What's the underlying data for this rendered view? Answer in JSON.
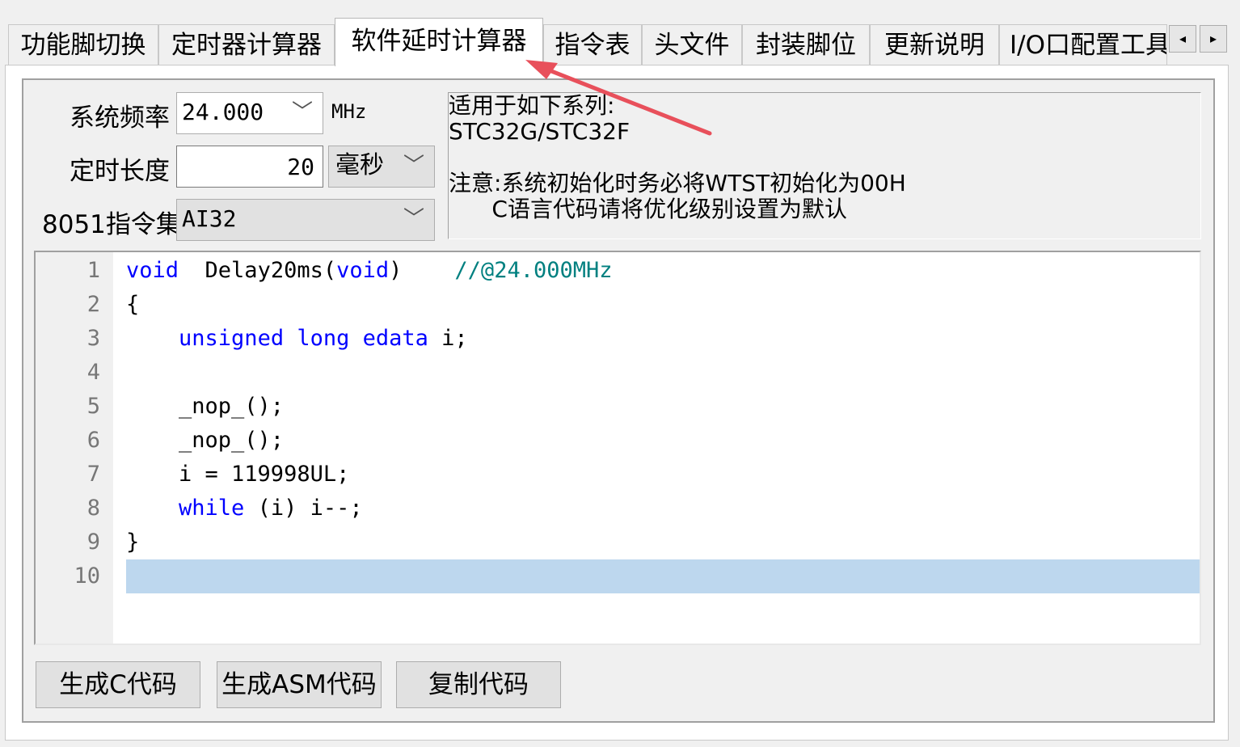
{
  "tabs": [
    {
      "label": "功能脚切换",
      "active": false
    },
    {
      "label": "定时器计算器",
      "active": false
    },
    {
      "label": "软件延时计算器",
      "active": true
    },
    {
      "label": "指令表",
      "active": false
    },
    {
      "label": "头文件",
      "active": false
    },
    {
      "label": "封装脚位",
      "active": false
    },
    {
      "label": "更新说明",
      "active": false
    },
    {
      "label": "I/O口配置工具",
      "active": false
    }
  ],
  "tab_scroll": {
    "left": "◂",
    "right": "▸"
  },
  "form": {
    "freq_label": "系统频率",
    "freq_value": "24.000",
    "freq_unit": "MHz",
    "length_label": "定时长度",
    "length_value": "20",
    "length_unit": "毫秒",
    "isa_label": "8051指令集",
    "isa_value": "AI32",
    "dropdown_glyph": "﹀"
  },
  "info": {
    "text": "适用于如下系列:\nSTC32G/STC32F\n\n注意:系统初始化时务必将WTST初始化为00H\n      C语言代码请将优化级别设置为默认"
  },
  "code": {
    "lines": [
      {
        "n": "1",
        "parts": [
          [
            "kw",
            "void"
          ],
          [
            "",
            "  Delay20ms("
          ],
          [
            "kw",
            "void"
          ],
          [
            "",
            ")    "
          ],
          [
            "cm",
            "//@24.000MHz"
          ]
        ]
      },
      {
        "n": "2",
        "parts": [
          [
            "",
            "{"
          ]
        ]
      },
      {
        "n": "3",
        "parts": [
          [
            "",
            "    "
          ],
          [
            "kw",
            "unsigned long edata"
          ],
          [
            "",
            " i;"
          ]
        ]
      },
      {
        "n": "4",
        "parts": []
      },
      {
        "n": "5",
        "parts": [
          [
            "",
            "    _nop_();"
          ]
        ]
      },
      {
        "n": "6",
        "parts": [
          [
            "",
            "    _nop_();"
          ]
        ]
      },
      {
        "n": "7",
        "parts": [
          [
            "",
            "    i = 119998UL;"
          ]
        ]
      },
      {
        "n": "8",
        "parts": [
          [
            "",
            "    "
          ],
          [
            "kw",
            "while"
          ],
          [
            "",
            " (i) i--;"
          ]
        ]
      },
      {
        "n": "9",
        "parts": [
          [
            "",
            "}"
          ]
        ]
      },
      {
        "n": "10",
        "parts": [],
        "current": true
      }
    ]
  },
  "buttons": {
    "gen_c": "生成C代码",
    "gen_asm": "生成ASM代码",
    "copy": "复制代码"
  },
  "colors": {
    "arrow": "#e8505b",
    "keyword": "#0000ff",
    "comment": "#008080",
    "highlight": "#bdd7ee"
  }
}
